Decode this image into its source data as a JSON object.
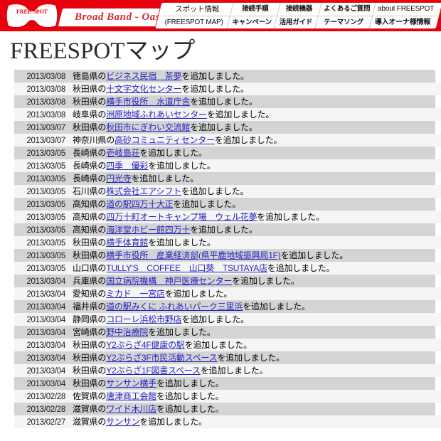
{
  "header": {
    "logo_text_top": "FREE",
    "logo_text_bottom": "SPOT",
    "brand": "Broad Band - Oasis",
    "nav": [
      {
        "top": "スポット情報",
        "bottom": "(FREESPOT MAP)"
      },
      {
        "top": "接続手順",
        "bottom": "キャンペーン"
      },
      {
        "top": "接続機器",
        "bottom": "活用ガイド"
      },
      {
        "top": "よくあるご質問",
        "bottom": "テーマソング"
      },
      {
        "top": "about FREESPOT",
        "bottom": "導入オーナ様情報"
      }
    ]
  },
  "page": {
    "title": "FREESPOTマップ"
  },
  "colors": {
    "header_red": "#e8000d",
    "brand_red": "#d8262f",
    "link_blue": "#2222bb",
    "row_odd": "#d4d4d4",
    "row_even": "#f5f5f5"
  },
  "news": [
    {
      "date": "2013/03/08",
      "pre": "徳島県の",
      "link": "ビジネス民宿　茶夢",
      "post": "を追加しました。"
    },
    {
      "date": "2013/03/08",
      "pre": "秋田県の",
      "link": "十文字文化センター",
      "post": "を追加しました。"
    },
    {
      "date": "2013/03/08",
      "pre": "秋田県の",
      "link": "横手市役所　水道庁舎",
      "post": "を追加しました。"
    },
    {
      "date": "2013/03/08",
      "pre": "岐阜県の",
      "link": "洲原地域ふれあいセンター",
      "post": "を追加しました。"
    },
    {
      "date": "2013/03/07",
      "pre": "秋田県の",
      "link": "秋田市にぎわい交流館",
      "post": "を追加しました。"
    },
    {
      "date": "2013/03/07",
      "pre": "神奈川県の",
      "link": "高砂コミュニティセンター",
      "post": "を追加しました。"
    },
    {
      "date": "2013/03/05",
      "pre": "長崎県の",
      "link": "壱岐島荘",
      "post": "を追加しました。"
    },
    {
      "date": "2013/03/05",
      "pre": "長崎県の",
      "link": "四季　優彩",
      "post": "を追加しました。"
    },
    {
      "date": "2013/03/05",
      "pre": "長崎県の",
      "link": "円光寺",
      "post": "を追加しました。"
    },
    {
      "date": "2013/03/05",
      "pre": "石川県の",
      "link": "株式会社エアシフト",
      "post": "を追加しました。"
    },
    {
      "date": "2013/03/05",
      "pre": "高知県の",
      "link": "道の駅四万十大正",
      "post": "を追加しました。"
    },
    {
      "date": "2013/03/05",
      "pre": "高知県の",
      "link": "四万十町オートキャンプ場　ウェル花夢",
      "post": "を追加しました。"
    },
    {
      "date": "2013/03/05",
      "pre": "高知県の",
      "link": "海洋堂ホビー館四万十",
      "post": "を追加しました。"
    },
    {
      "date": "2013/03/05",
      "pre": "秋田県の",
      "link": "横手体育館",
      "post": "を追加しました。"
    },
    {
      "date": "2013/03/05",
      "pre": "秋田県の",
      "link": "横手市役所　産業経済部(県平鹿地域振興局1F)",
      "post": "を追加しました。"
    },
    {
      "date": "2013/03/05",
      "pre": "山口県の",
      "link": "TULLY'S　COFFEE　山口葵　TSUTAYA店",
      "post": "を追加しました。"
    },
    {
      "date": "2013/03/04",
      "pre": "兵庫県の",
      "link": "国立病院機構　神戸医療センター",
      "post": "を追加しました。"
    },
    {
      "date": "2013/03/04",
      "pre": "愛知県の",
      "link": "ミカド　一宮店",
      "post": "を追加しました。"
    },
    {
      "date": "2013/03/04",
      "pre": "福井県の",
      "link": "道の駅みくに ふれあいパーク三里浜",
      "post": "を追加しました。"
    },
    {
      "date": "2013/03/04",
      "pre": "静岡県の",
      "link": "コローレ浜松市野店",
      "post": "を追加しました。"
    },
    {
      "date": "2013/03/04",
      "pre": "宮崎県の",
      "link": "野中治療院",
      "post": "を追加しました。"
    },
    {
      "date": "2013/03/04",
      "pre": "秋田県の",
      "link": "Y2ぷらざ4F健康の駅",
      "post": "を追加しました。"
    },
    {
      "date": "2013/03/04",
      "pre": "秋田県の",
      "link": "Y2ぷらざ3F市民活動スペース",
      "post": "を追加しました。"
    },
    {
      "date": "2013/03/04",
      "pre": "秋田県の",
      "link": "Y2ぷらざ1F図書スペース",
      "post": "を追加しました。"
    },
    {
      "date": "2013/03/04",
      "pre": "秋田県の",
      "link": "サンサン横手",
      "post": "を追加しました。"
    },
    {
      "date": "2013/02/28",
      "pre": "佐賀県の",
      "link": "唐津商工会館",
      "post": "を追加しました。"
    },
    {
      "date": "2013/02/28",
      "pre": "滋賀県の",
      "link": "ワイド木川店",
      "post": "を追加しました。"
    },
    {
      "date": "2013/02/27",
      "pre": "滋賀県の",
      "link": "サンサン",
      "post": "を追加しました。"
    }
  ]
}
